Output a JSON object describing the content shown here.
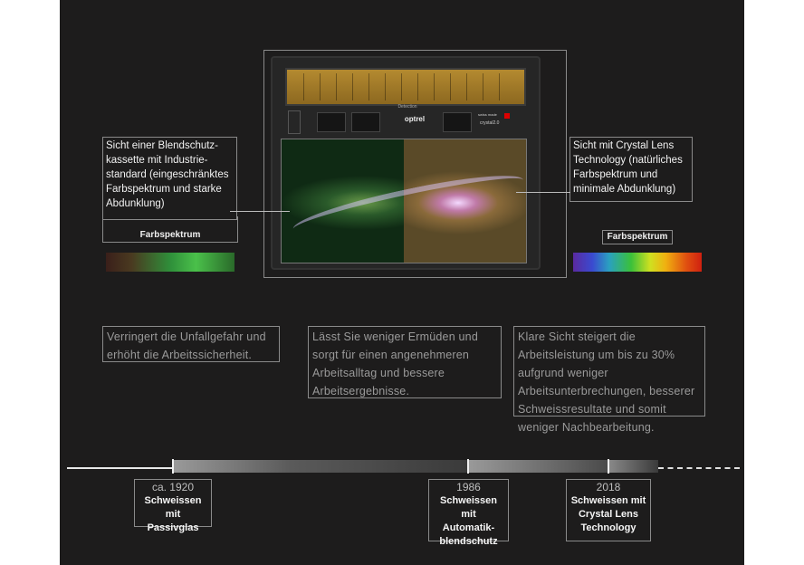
{
  "callouts": {
    "left": "Sicht einer Blendschutz-kassette mit Industrie-standard (eingeschränktes Farbspektrum und starke Abdunklung)",
    "right": "Sicht mit Crystal Lens Technology (natürliches Farbspektrum und minimale Abdunklung)"
  },
  "spectrum": {
    "left_label": "Farbspektrum",
    "right_label": "Farbspektrum"
  },
  "device": {
    "detection_label": "Detection",
    "brand": "optrel",
    "swiss_label": "swiss made",
    "model": "crystal2.0"
  },
  "benefits": [
    "Verringert die Unfallgefahr und erhöht die Arbeitssicherheit.",
    "Lässt Sie weniger Ermüden und sorgt für einen angenehmeren Arbeitsalltag und bessere Arbeitsergebnisse.",
    "Klare Sicht steigert die Arbeitsleistung um bis zu 30% aufgrund weniger Arbeitsunterbrechungen, besserer Schweissresultate und somit weniger Nachbearbeitung."
  ],
  "timeline": [
    {
      "year": "ca. 1920",
      "text": "Schweissen mit Passivglas"
    },
    {
      "year": "1986",
      "text": "Schweissen mit Automatik-blendschutz"
    },
    {
      "year": "2018",
      "text": "Schweissen mit Crystal Lens Technology"
    }
  ],
  "colors": {
    "background": "#1d1c1c",
    "border": "#8a8a8a",
    "solar_panel": "#a07a28"
  }
}
